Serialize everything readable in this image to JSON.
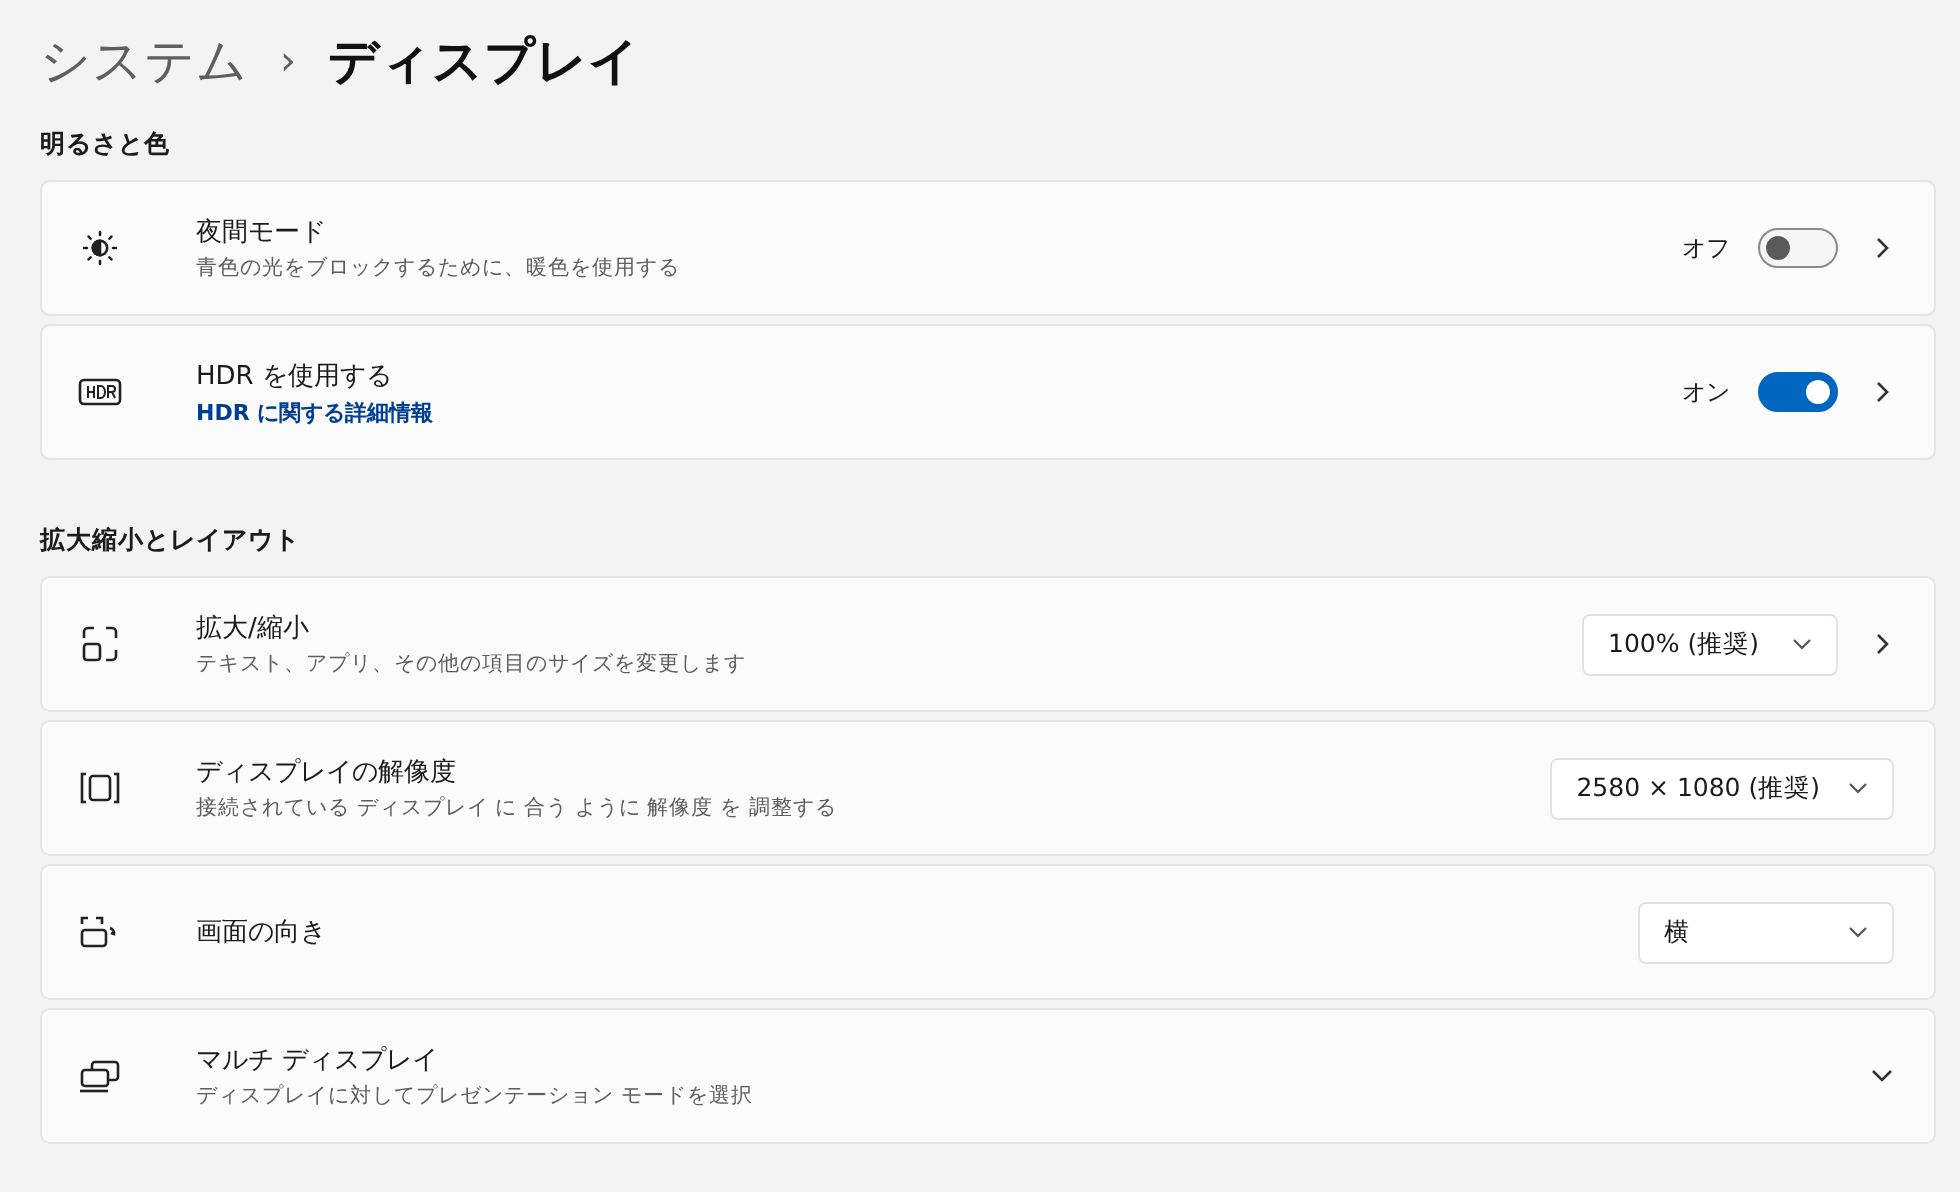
{
  "breadcrumb": {
    "parent": "システム",
    "separator": "›",
    "current": "ディスプレイ"
  },
  "sections": [
    {
      "heading": "明るさと色",
      "rows": [
        {
          "kind": "toggle",
          "title": "夜間モード",
          "description": "青色の光をブロックするために、暖色を使用する",
          "state_label": "オフ",
          "on": false
        },
        {
          "kind": "toggle",
          "title": "HDR を使用する",
          "link": "HDR に関する詳細情報",
          "state_label": "オン",
          "on": true
        }
      ]
    },
    {
      "heading": "拡大縮小とレイアウト",
      "rows": [
        {
          "kind": "combo",
          "title": "拡大/縮小",
          "description": "テキスト、アプリ、その他の項目のサイズを変更します",
          "value": "100% (推奨)"
        },
        {
          "kind": "dropdown",
          "title": "ディスプレイの解像度",
          "description": "接続されている ディスプレイ に 合う ように 解像度 を 調整する",
          "value": "2580 × 1080 (推奨)"
        },
        {
          "kind": "dropdown",
          "title": "画面の向き",
          "value": "横"
        },
        {
          "kind": "expander",
          "title": "マルチ ディスプレイ",
          "description": "ディスプレイに対してプレゼンテーション モードを選択"
        }
      ]
    }
  ]
}
